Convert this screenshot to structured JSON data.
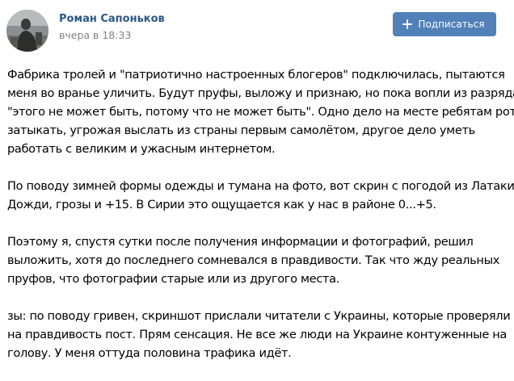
{
  "post": {
    "author": {
      "name": "Роман Сапоньков",
      "date": "вчера в 18:33"
    },
    "subscribe": {
      "icon": "plus-icon",
      "label": "Подписаться",
      "color": "#5181b8"
    },
    "paragraphs": [
      {
        "lines": [
          "Фабрика тролей и \"патриотично настроенных блогеров\" подключилась, пытаются",
          "меня во вранье уличить. Будут пруфы, выложу и признаю, но пока вопли из разряда",
          "\"этого не может быть, потому что не может быть\". Одно дело на месте ребятам рот",
          "затыкать, угрожая выслать из страны первым самолётом, другое дело уметь",
          "работать с великим и ужасным интернетом."
        ]
      },
      {
        "lines": [
          "По поводу зимней формы одежды и тумана на фото, вот скрин с погодой из Латакии.",
          "Дожди, грозы и +15. В Сирии это ощущается как у нас в районе 0...+5."
        ]
      },
      {
        "lines": [
          "Поэтому я, спустя сутки после получения информации и фотографий, решил",
          "выложить, хотя до последнего сомневался в правдивости. Так что жду реальных",
          "пруфов, что фотографии старые или из другого места."
        ]
      },
      {
        "lines": [
          "зы: по поводу гривен, скриншот прислали читатели с Украины, которые проверяли",
          "на правдивость пост. Прям сенсация. Не все же люди на Украине контуженные на",
          "голову. У меня оттуда половина трафика идёт."
        ]
      }
    ]
  }
}
